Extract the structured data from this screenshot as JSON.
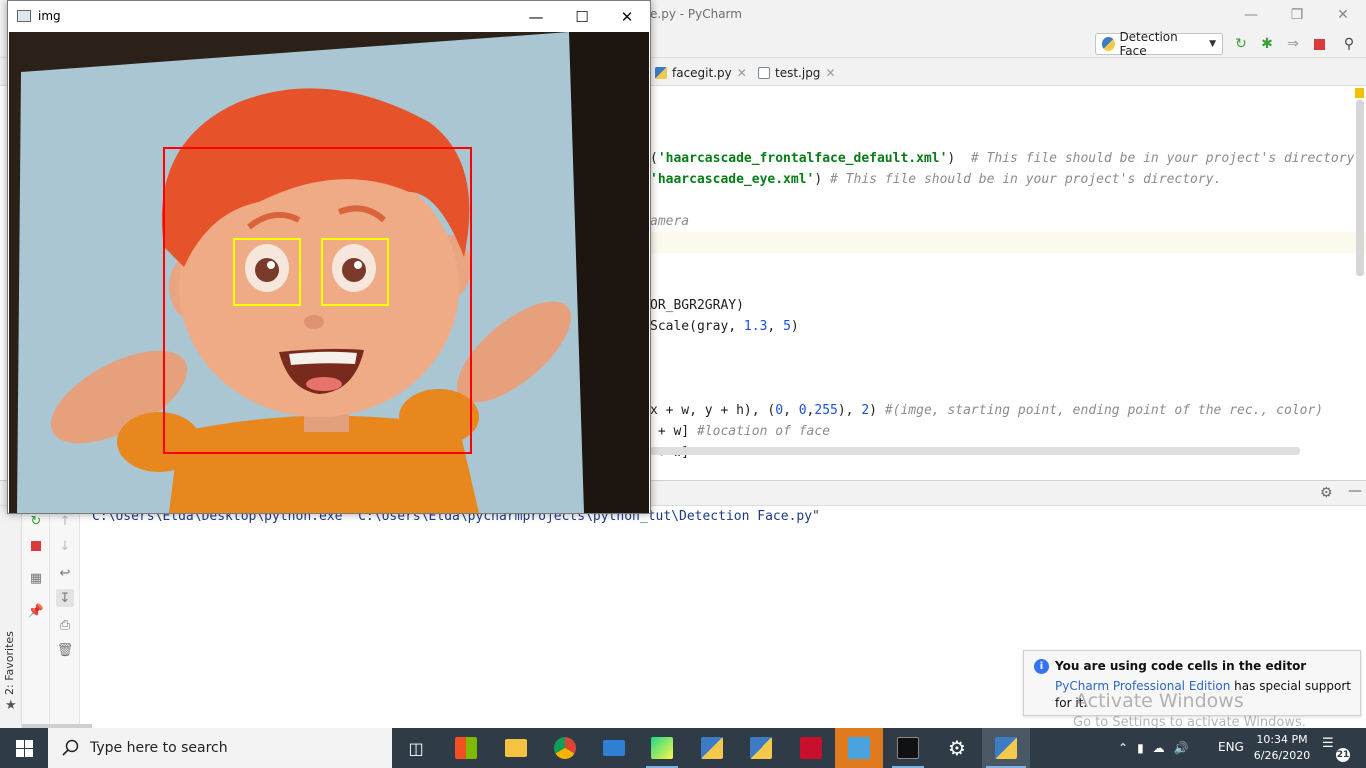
{
  "pycharm": {
    "title_fragment": "e.py - PyCharm",
    "run_config_label": "Detection Face",
    "tabs": [
      {
        "label": "facegit.py"
      },
      {
        "label": "test.jpg"
      }
    ],
    "code_lines": [
      {
        "pre": "(",
        "str": "'haarcascade_frontalface_default.xml'",
        "post": ")  ",
        "cmt": "# This file should be in your project's directory"
      },
      {
        "pre": "",
        "str": "'haarcascade_eye.xml'",
        "post": ") ",
        "cmt": "# This file should be in your project's directory."
      },
      {
        "pre": "",
        "str": "",
        "post": "",
        "cmt": "amera"
      },
      {
        "pre": "OR_BGR2GRAY)",
        "str": "",
        "post": "",
        "cmt": ""
      },
      {
        "pre": "Scale(gray, ",
        "num1": "1.3",
        "mid": ", ",
        "num2": "5",
        "end": ")"
      },
      {
        "pre": "x + w, y + h), (",
        "n1": "0",
        "c1": ", ",
        "n2": "0",
        "c2": ",",
        "n3": "255",
        "c3": "), ",
        "n4": "2",
        "c4": ") ",
        "cmt": "#(imge, starting point, ending point of the rec., color)"
      },
      {
        "pre": " + w] ",
        "cmt": "#location of face"
      },
      {
        "pre": " + w]"
      }
    ],
    "console_command": "C:\\Users\\Elda\\Desktop\\python.exe \"C:\\Users\\Elda\\pycharmprojects\\python_tut\\Detection Face.py\"",
    "favorites_label": "2: Favorites"
  },
  "notification": {
    "title": "You are using code cells in the editor",
    "link": "PyCharm Professional Edition",
    "body_after_link": " has special support",
    "body_line2": "for it."
  },
  "watermark": {
    "line1": "Activate Windows",
    "line2": "Go to Settings to activate Windows."
  },
  "img_window": {
    "title": "img"
  },
  "taskbar": {
    "search_placeholder": "Type here to search",
    "language": "ENG",
    "time": "10:34 PM",
    "date": "6/26/2020",
    "notification_count": "21"
  },
  "colors": {
    "face_box": "#ff0000",
    "eye_box": "#ffff00",
    "taskbar": "#2f3b46"
  }
}
